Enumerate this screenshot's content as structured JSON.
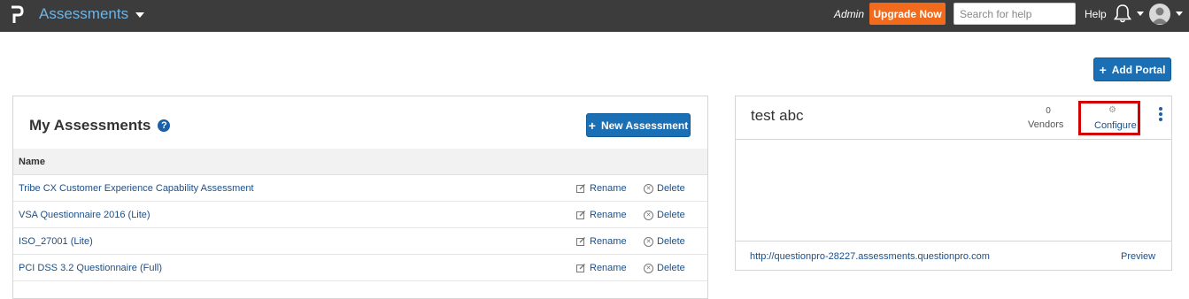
{
  "topbar": {
    "app_title": "Assessments",
    "admin_label": "Admin",
    "upgrade_label": "Upgrade Now",
    "search_placeholder": "Search for help",
    "help_label": "Help"
  },
  "actions": {
    "add_portal_label": "Add Portal",
    "new_assessment_label": "New Assessment"
  },
  "assessments": {
    "title": "My Assessments",
    "column_name": "Name",
    "rename_label": "Rename",
    "delete_label": "Delete",
    "rows": [
      {
        "name": "Tribe CX Customer Experience Capability Assessment"
      },
      {
        "name": "VSA Questionnaire 2016 (Lite)"
      },
      {
        "name": "ISO_27001 (Lite)"
      },
      {
        "name": "PCI DSS 3.2 Questionnaire (Full)"
      }
    ]
  },
  "portal": {
    "title": "test abc",
    "vendor_count": "0",
    "vendors_label": "Vendors",
    "configure_label": "Configure",
    "url": "http://questionpro-28227.assessments.questionpro.com",
    "preview_label": "Preview"
  },
  "colors": {
    "topbar": "#3c3c3c",
    "accent_blue": "#1a6fb5",
    "upgrade_orange": "#f26b1d",
    "highlight_red": "#d20000"
  },
  "icons": [
    "questionpro-logo-icon",
    "caret-down-icon",
    "bell-icon",
    "user-avatar-icon",
    "plus-icon",
    "help-circle-icon",
    "edit-icon",
    "delete-circle-icon",
    "gear-icon",
    "kebab-menu-icon"
  ]
}
